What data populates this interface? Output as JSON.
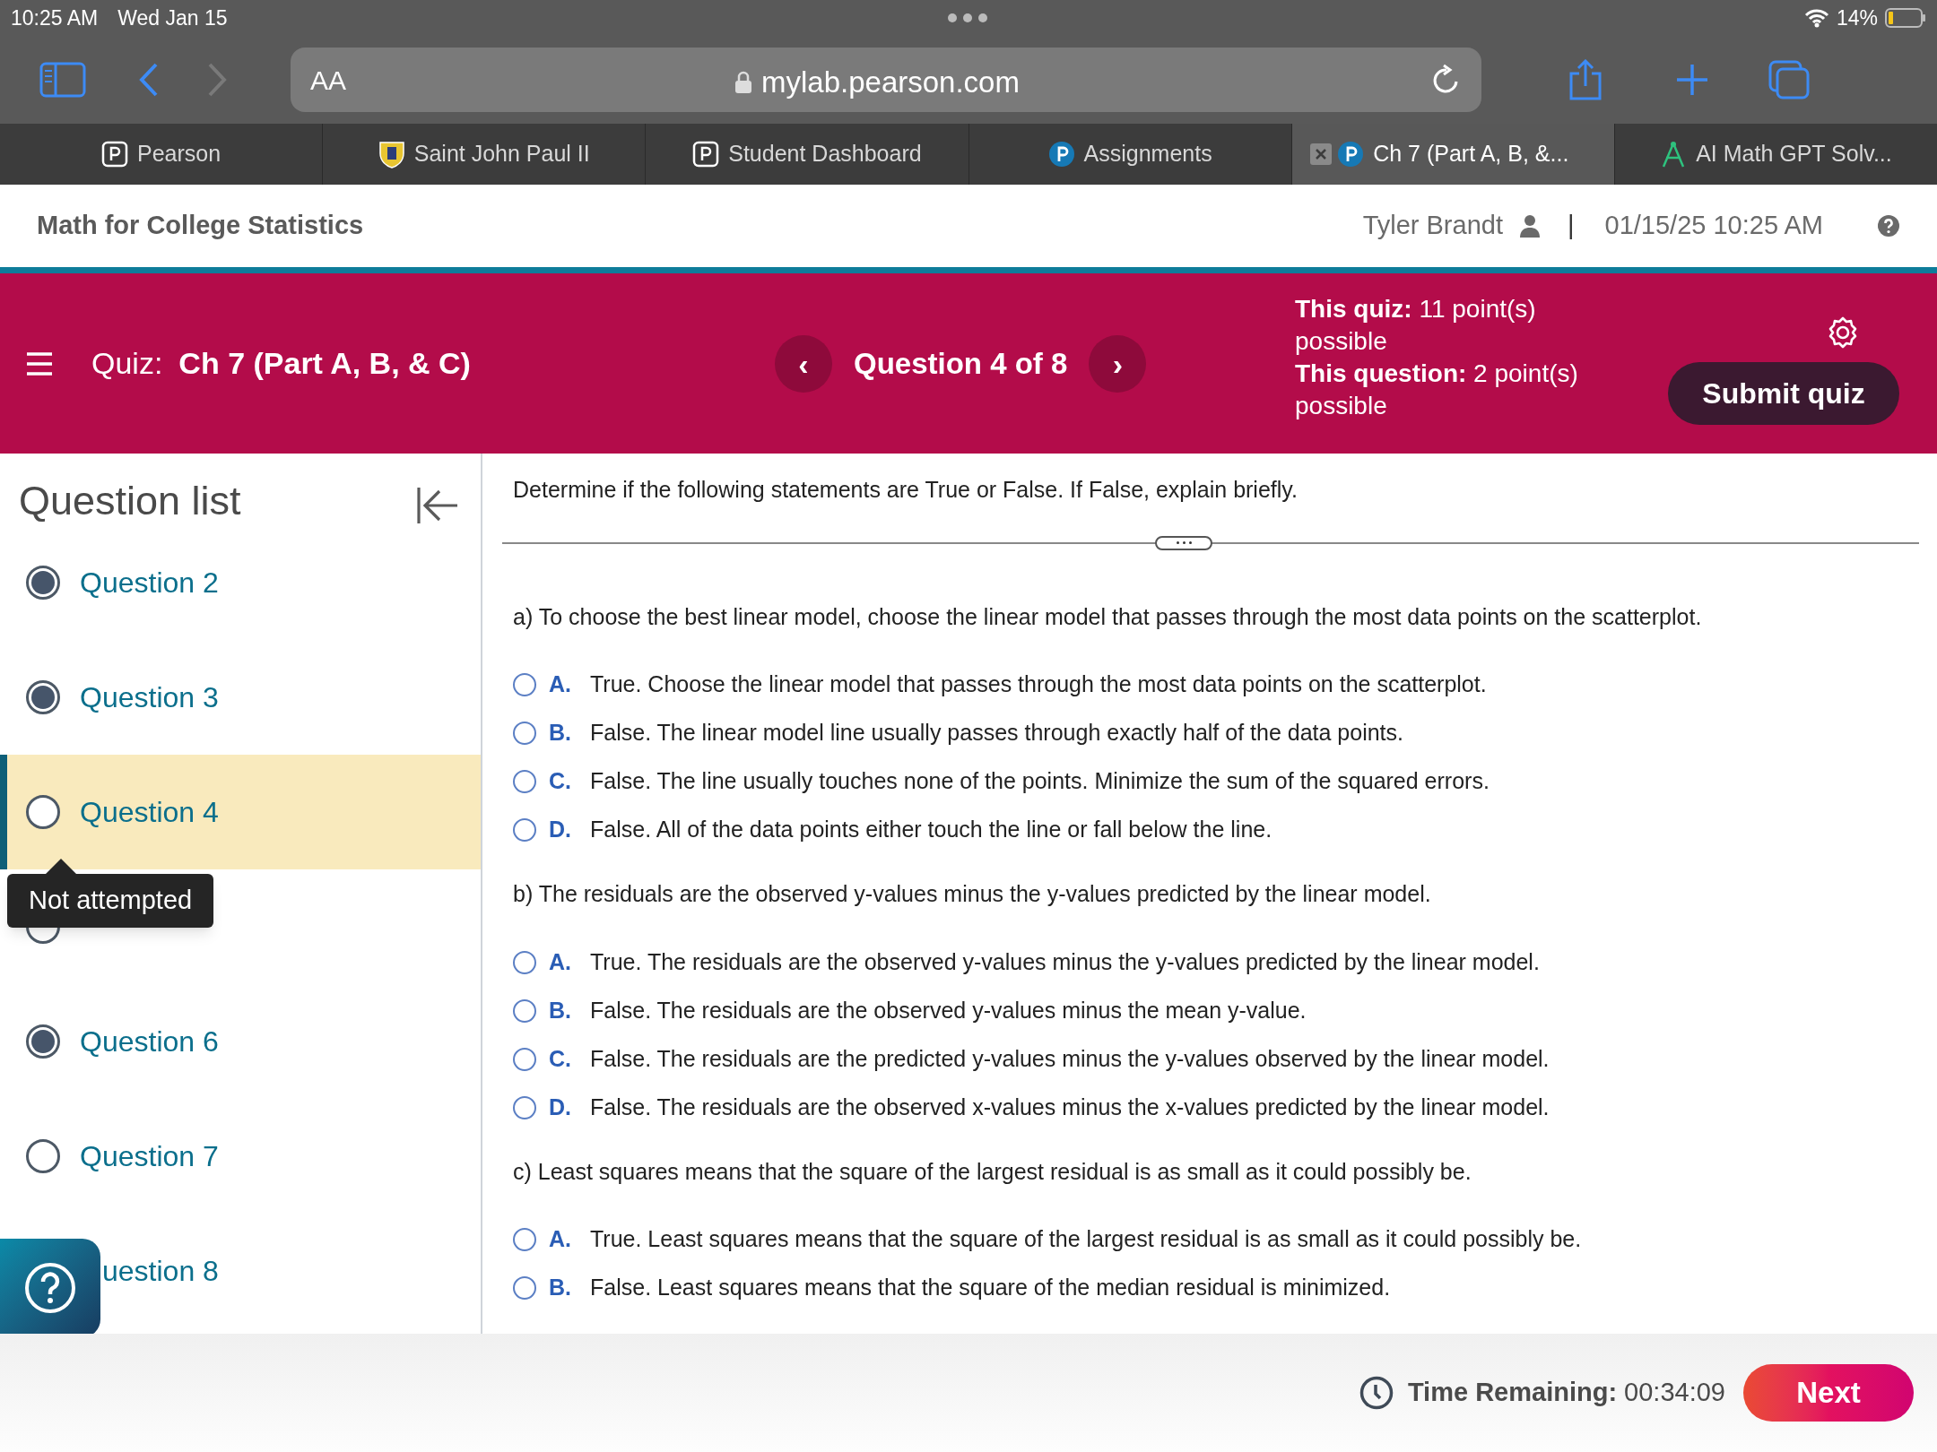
{
  "status_bar": {
    "time": "10:25 AM",
    "date": "Wed Jan 15",
    "battery": "14%"
  },
  "browser": {
    "text_size_button": "AA",
    "url": "mylab.pearson.com",
    "tabs": [
      {
        "label": "Pearson",
        "selected": false
      },
      {
        "label": "Saint John Paul II",
        "selected": false
      },
      {
        "label": "Student Dashboard",
        "selected": false
      },
      {
        "label": "Assignments",
        "selected": false
      },
      {
        "label": "Ch 7 (Part A, B, &...",
        "selected": true
      },
      {
        "label": "AI Math GPT Solv...",
        "selected": false
      }
    ]
  },
  "site_header": {
    "course": "Math for College Statistics",
    "user": "Tyler Brandt",
    "separator": "|",
    "datetime": "01/15/25 10:25 AM"
  },
  "quiz_bar": {
    "quiz_label": "Quiz:",
    "quiz_name": "Ch 7 (Part A, B, & C)",
    "question_position": "Question 4 of 8",
    "prev": "‹",
    "next": "›",
    "points": [
      "**This quiz:** 11 point(s) possible",
      "**This question:** 2 point(s) possible"
    ],
    "submit": "Submit quiz"
  },
  "question_list": {
    "title": "Question list",
    "items": [
      {
        "label": "Question 2",
        "answered": true,
        "selected": false
      },
      {
        "label": "Question 3",
        "answered": true,
        "selected": false
      },
      {
        "label": "Question 4",
        "answered": false,
        "selected": true
      },
      {
        "selected": false
      },
      {
        "label": "Question 6",
        "answered": true,
        "selected": false
      },
      {
        "label": "Question 7",
        "answered": false,
        "selected": false
      },
      {
        "label": "uestion 8",
        "selected": false
      }
    ],
    "tooltip": "Not attempted"
  },
  "question": {
    "instruction": "Determine if the following statements are True or False. If False, explain briefly.",
    "parts": [
      {
        "prompt": "a) To choose the best linear model, choose the linear model that passes through the most data points on the scatterplot.",
        "options": [
          {
            "letter": "A.",
            "text": "True. Choose the linear model that passes through the most data points on the scatterplot.",
            "selected": false
          },
          {
            "letter": "B.",
            "text": "False. The linear model line usually passes through exactly half of the data points.",
            "selected": false
          },
          {
            "letter": "C.",
            "text": "False. The line usually touches none of the points. Minimize the sum of the squared errors.",
            "selected": false
          },
          {
            "letter": "D.",
            "text": "False. All of the data points either touch the line or fall below the line.",
            "selected": false
          }
        ]
      },
      {
        "prompt": "b) The residuals are the observed y-values minus the y-values predicted by the linear model.",
        "options": [
          {
            "letter": "A.",
            "text": "True. The residuals are the observed y-values minus the y-values predicted by the linear model.",
            "selected": false
          },
          {
            "letter": "B.",
            "text": "False. The residuals are the observed y-values minus the mean y-value.",
            "selected": false
          },
          {
            "letter": "C.",
            "text": "False. The residuals are the predicted y-values minus the y-values observed by the linear model.",
            "selected": false
          },
          {
            "letter": "D.",
            "text": "False. The residuals are the observed x-values minus the x-values predicted by the linear model.",
            "selected": false
          }
        ]
      },
      {
        "prompt": "c) Least squares means that the square of the largest residual is as small as it could possibly be.",
        "options": [
          {
            "letter": "A.",
            "text": "True. Least squares means that the square of the largest residual is as small as it could possibly be.",
            "selected": false
          },
          {
            "letter": "B.",
            "text": "False. Least squares means that the square of the median residual is minimized.",
            "selected": false
          }
        ]
      }
    ]
  },
  "footer": {
    "time_label": "Time Remaining:",
    "time_value": "00:34:09",
    "next": "Next"
  }
}
